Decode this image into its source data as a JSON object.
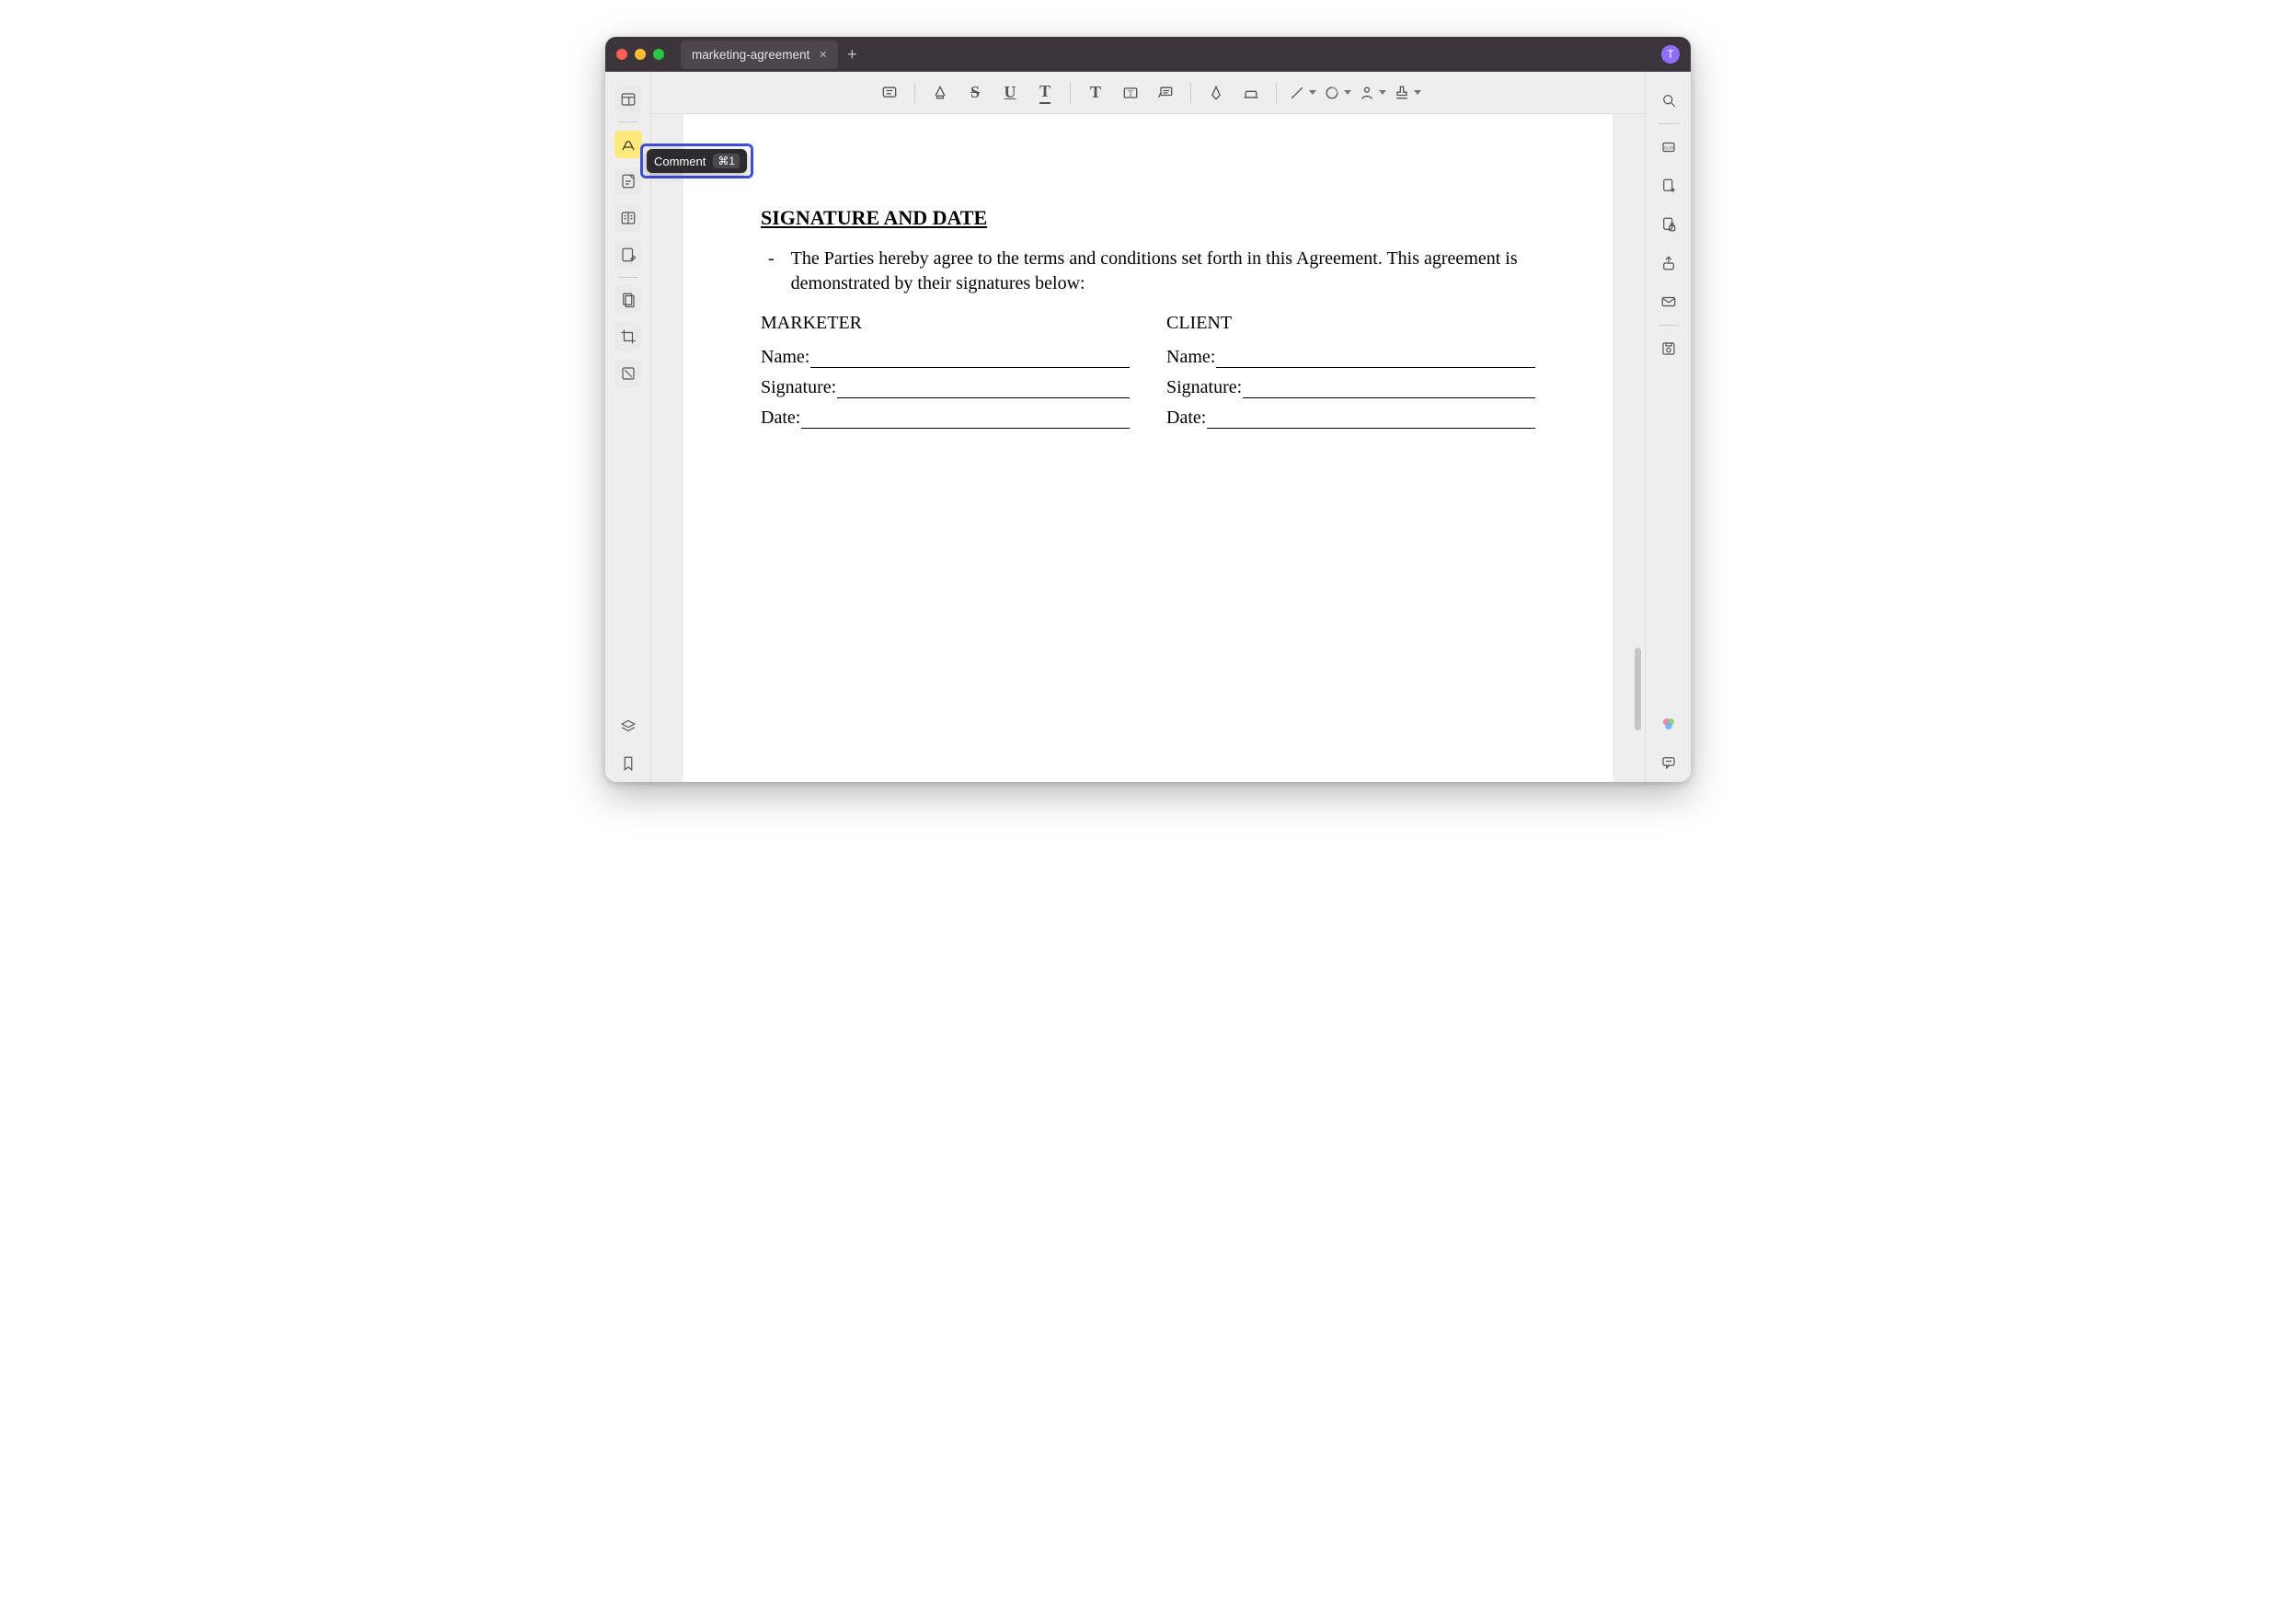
{
  "tab": {
    "title": "marketing-agreement"
  },
  "avatar_letter": "T",
  "tooltip": {
    "label": "Comment",
    "shortcut": "⌘1"
  },
  "document": {
    "heading": "SIGNATURE AND DATE",
    "paragraph": "The Parties hereby agree to the terms and conditions set forth in this Agreement. This agreement is demonstrated by their signatures below:",
    "marketer": {
      "title": "MARKETER",
      "name_label": "Name:",
      "signature_label": "Signature:",
      "date_label": "Date:"
    },
    "client": {
      "title": "CLIENT",
      "name_label": "Name:",
      "signature_label": "Signature:",
      "date_label": "Date:"
    }
  }
}
